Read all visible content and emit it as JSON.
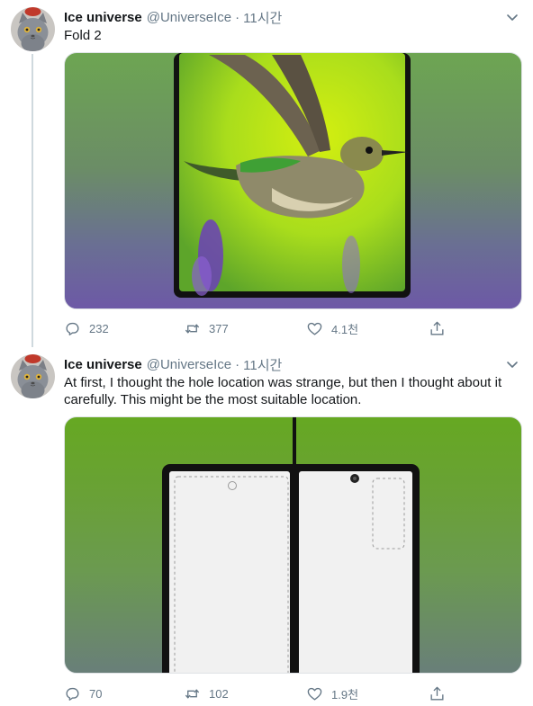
{
  "tweets": [
    {
      "display_name": "Ice universe",
      "handle": "@UniverseIce",
      "separator": "·",
      "time": "11시간",
      "text": "Fold 2",
      "replies": "232",
      "retweets": "377",
      "likes": "4.1천",
      "avatar_icon": "cat-avatar-icon",
      "media_description": "hummingbird-on-foldable-phone"
    },
    {
      "display_name": "Ice universe",
      "handle": "@UniverseIce",
      "separator": "·",
      "time": "11시간",
      "text": "At first, I thought the hole location was strange, but then I thought about it carefully. This might be the most suitable location.",
      "replies": "70",
      "retweets": "102",
      "likes": "1.9천",
      "avatar_icon": "cat-avatar-icon",
      "media_description": "foldable-phone-layout-diagram"
    }
  ],
  "colors": {
    "name": "#14171a",
    "secondary": "#657786",
    "thread_line": "#cfd9de",
    "photo_bg_top": "#66a822",
    "photo_bg_bottom": "#6d59a6"
  }
}
